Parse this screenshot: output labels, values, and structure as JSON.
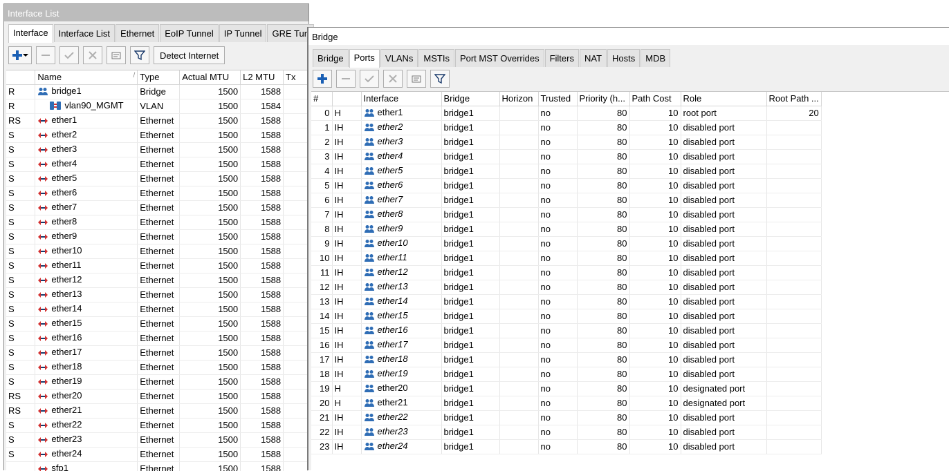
{
  "interface_window": {
    "title": "Interface List",
    "tabs": [
      "Interface",
      "Interface List",
      "Ethernet",
      "EoIP Tunnel",
      "IP Tunnel",
      "GRE Tun"
    ],
    "detect_button": "Detect Internet",
    "columns": [
      "",
      "Name",
      "Type",
      "Actual MTU",
      "L2 MTU",
      "Tx"
    ],
    "rows": [
      {
        "flags": "R",
        "name": "bridge1",
        "type": "Bridge",
        "mtu": "1500",
        "l2mtu": "1588",
        "icon": "bridge-icon"
      },
      {
        "flags": "R",
        "name": "vlan90_MGMT",
        "type": "VLAN",
        "mtu": "1500",
        "l2mtu": "1584",
        "icon": "vlan-icon"
      },
      {
        "flags": "RS",
        "name": "ether1",
        "type": "Ethernet",
        "mtu": "1500",
        "l2mtu": "1588",
        "icon": "ethernet-icon"
      },
      {
        "flags": "S",
        "name": "ether2",
        "type": "Ethernet",
        "mtu": "1500",
        "l2mtu": "1588",
        "icon": "ethernet-icon"
      },
      {
        "flags": "S",
        "name": "ether3",
        "type": "Ethernet",
        "mtu": "1500",
        "l2mtu": "1588",
        "icon": "ethernet-icon"
      },
      {
        "flags": "S",
        "name": "ether4",
        "type": "Ethernet",
        "mtu": "1500",
        "l2mtu": "1588",
        "icon": "ethernet-icon"
      },
      {
        "flags": "S",
        "name": "ether5",
        "type": "Ethernet",
        "mtu": "1500",
        "l2mtu": "1588",
        "icon": "ethernet-icon"
      },
      {
        "flags": "S",
        "name": "ether6",
        "type": "Ethernet",
        "mtu": "1500",
        "l2mtu": "1588",
        "icon": "ethernet-icon"
      },
      {
        "flags": "S",
        "name": "ether7",
        "type": "Ethernet",
        "mtu": "1500",
        "l2mtu": "1588",
        "icon": "ethernet-icon"
      },
      {
        "flags": "S",
        "name": "ether8",
        "type": "Ethernet",
        "mtu": "1500",
        "l2mtu": "1588",
        "icon": "ethernet-icon"
      },
      {
        "flags": "S",
        "name": "ether9",
        "type": "Ethernet",
        "mtu": "1500",
        "l2mtu": "1588",
        "icon": "ethernet-icon"
      },
      {
        "flags": "S",
        "name": "ether10",
        "type": "Ethernet",
        "mtu": "1500",
        "l2mtu": "1588",
        "icon": "ethernet-icon"
      },
      {
        "flags": "S",
        "name": "ether11",
        "type": "Ethernet",
        "mtu": "1500",
        "l2mtu": "1588",
        "icon": "ethernet-icon"
      },
      {
        "flags": "S",
        "name": "ether12",
        "type": "Ethernet",
        "mtu": "1500",
        "l2mtu": "1588",
        "icon": "ethernet-icon"
      },
      {
        "flags": "S",
        "name": "ether13",
        "type": "Ethernet",
        "mtu": "1500",
        "l2mtu": "1588",
        "icon": "ethernet-icon"
      },
      {
        "flags": "S",
        "name": "ether14",
        "type": "Ethernet",
        "mtu": "1500",
        "l2mtu": "1588",
        "icon": "ethernet-icon"
      },
      {
        "flags": "S",
        "name": "ether15",
        "type": "Ethernet",
        "mtu": "1500",
        "l2mtu": "1588",
        "icon": "ethernet-icon"
      },
      {
        "flags": "S",
        "name": "ether16",
        "type": "Ethernet",
        "mtu": "1500",
        "l2mtu": "1588",
        "icon": "ethernet-icon"
      },
      {
        "flags": "S",
        "name": "ether17",
        "type": "Ethernet",
        "mtu": "1500",
        "l2mtu": "1588",
        "icon": "ethernet-icon"
      },
      {
        "flags": "S",
        "name": "ether18",
        "type": "Ethernet",
        "mtu": "1500",
        "l2mtu": "1588",
        "icon": "ethernet-icon"
      },
      {
        "flags": "S",
        "name": "ether19",
        "type": "Ethernet",
        "mtu": "1500",
        "l2mtu": "1588",
        "icon": "ethernet-icon"
      },
      {
        "flags": "RS",
        "name": "ether20",
        "type": "Ethernet",
        "mtu": "1500",
        "l2mtu": "1588",
        "icon": "ethernet-icon"
      },
      {
        "flags": "RS",
        "name": "ether21",
        "type": "Ethernet",
        "mtu": "1500",
        "l2mtu": "1588",
        "icon": "ethernet-icon"
      },
      {
        "flags": "S",
        "name": "ether22",
        "type": "Ethernet",
        "mtu": "1500",
        "l2mtu": "1588",
        "icon": "ethernet-icon"
      },
      {
        "flags": "S",
        "name": "ether23",
        "type": "Ethernet",
        "mtu": "1500",
        "l2mtu": "1588",
        "icon": "ethernet-icon"
      },
      {
        "flags": "S",
        "name": "ether24",
        "type": "Ethernet",
        "mtu": "1500",
        "l2mtu": "1588",
        "icon": "ethernet-icon"
      },
      {
        "flags": "",
        "name": "sfp1",
        "type": "Ethernet",
        "mtu": "1500",
        "l2mtu": "1588",
        "icon": "ethernet-icon"
      }
    ]
  },
  "bridge_window": {
    "title": "Bridge",
    "tabs": [
      "Bridge",
      "Ports",
      "VLANs",
      "MSTIs",
      "Port MST Overrides",
      "Filters",
      "NAT",
      "Hosts",
      "MDB"
    ],
    "active_tab": "Ports",
    "columns": [
      "#",
      "",
      "Interface",
      "Bridge",
      "Horizon",
      "Trusted",
      "Priority (h...",
      "Path Cost",
      "Role",
      "Root Path ..."
    ],
    "rows": [
      {
        "n": "0",
        "flags": "H",
        "iface": "ether1",
        "bridge": "bridge1",
        "horizon": "",
        "trusted": "no",
        "priority": "80",
        "cost": "10",
        "role": "root port",
        "rootpath": "20",
        "disabled": false
      },
      {
        "n": "1",
        "flags": "IH",
        "iface": "ether2",
        "bridge": "bridge1",
        "horizon": "",
        "trusted": "no",
        "priority": "80",
        "cost": "10",
        "role": "disabled port",
        "rootpath": "",
        "disabled": true
      },
      {
        "n": "2",
        "flags": "IH",
        "iface": "ether3",
        "bridge": "bridge1",
        "horizon": "",
        "trusted": "no",
        "priority": "80",
        "cost": "10",
        "role": "disabled port",
        "rootpath": "",
        "disabled": true
      },
      {
        "n": "3",
        "flags": "IH",
        "iface": "ether4",
        "bridge": "bridge1",
        "horizon": "",
        "trusted": "no",
        "priority": "80",
        "cost": "10",
        "role": "disabled port",
        "rootpath": "",
        "disabled": true
      },
      {
        "n": "4",
        "flags": "IH",
        "iface": "ether5",
        "bridge": "bridge1",
        "horizon": "",
        "trusted": "no",
        "priority": "80",
        "cost": "10",
        "role": "disabled port",
        "rootpath": "",
        "disabled": true
      },
      {
        "n": "5",
        "flags": "IH",
        "iface": "ether6",
        "bridge": "bridge1",
        "horizon": "",
        "trusted": "no",
        "priority": "80",
        "cost": "10",
        "role": "disabled port",
        "rootpath": "",
        "disabled": true
      },
      {
        "n": "6",
        "flags": "IH",
        "iface": "ether7",
        "bridge": "bridge1",
        "horizon": "",
        "trusted": "no",
        "priority": "80",
        "cost": "10",
        "role": "disabled port",
        "rootpath": "",
        "disabled": true
      },
      {
        "n": "7",
        "flags": "IH",
        "iface": "ether8",
        "bridge": "bridge1",
        "horizon": "",
        "trusted": "no",
        "priority": "80",
        "cost": "10",
        "role": "disabled port",
        "rootpath": "",
        "disabled": true
      },
      {
        "n": "8",
        "flags": "IH",
        "iface": "ether9",
        "bridge": "bridge1",
        "horizon": "",
        "trusted": "no",
        "priority": "80",
        "cost": "10",
        "role": "disabled port",
        "rootpath": "",
        "disabled": true
      },
      {
        "n": "9",
        "flags": "IH",
        "iface": "ether10",
        "bridge": "bridge1",
        "horizon": "",
        "trusted": "no",
        "priority": "80",
        "cost": "10",
        "role": "disabled port",
        "rootpath": "",
        "disabled": true
      },
      {
        "n": "10",
        "flags": "IH",
        "iface": "ether11",
        "bridge": "bridge1",
        "horizon": "",
        "trusted": "no",
        "priority": "80",
        "cost": "10",
        "role": "disabled port",
        "rootpath": "",
        "disabled": true
      },
      {
        "n": "11",
        "flags": "IH",
        "iface": "ether12",
        "bridge": "bridge1",
        "horizon": "",
        "trusted": "no",
        "priority": "80",
        "cost": "10",
        "role": "disabled port",
        "rootpath": "",
        "disabled": true
      },
      {
        "n": "12",
        "flags": "IH",
        "iface": "ether13",
        "bridge": "bridge1",
        "horizon": "",
        "trusted": "no",
        "priority": "80",
        "cost": "10",
        "role": "disabled port",
        "rootpath": "",
        "disabled": true
      },
      {
        "n": "13",
        "flags": "IH",
        "iface": "ether14",
        "bridge": "bridge1",
        "horizon": "",
        "trusted": "no",
        "priority": "80",
        "cost": "10",
        "role": "disabled port",
        "rootpath": "",
        "disabled": true
      },
      {
        "n": "14",
        "flags": "IH",
        "iface": "ether15",
        "bridge": "bridge1",
        "horizon": "",
        "trusted": "no",
        "priority": "80",
        "cost": "10",
        "role": "disabled port",
        "rootpath": "",
        "disabled": true
      },
      {
        "n": "15",
        "flags": "IH",
        "iface": "ether16",
        "bridge": "bridge1",
        "horizon": "",
        "trusted": "no",
        "priority": "80",
        "cost": "10",
        "role": "disabled port",
        "rootpath": "",
        "disabled": true
      },
      {
        "n": "16",
        "flags": "IH",
        "iface": "ether17",
        "bridge": "bridge1",
        "horizon": "",
        "trusted": "no",
        "priority": "80",
        "cost": "10",
        "role": "disabled port",
        "rootpath": "",
        "disabled": true
      },
      {
        "n": "17",
        "flags": "IH",
        "iface": "ether18",
        "bridge": "bridge1",
        "horizon": "",
        "trusted": "no",
        "priority": "80",
        "cost": "10",
        "role": "disabled port",
        "rootpath": "",
        "disabled": true
      },
      {
        "n": "18",
        "flags": "IH",
        "iface": "ether19",
        "bridge": "bridge1",
        "horizon": "",
        "trusted": "no",
        "priority": "80",
        "cost": "10",
        "role": "disabled port",
        "rootpath": "",
        "disabled": true
      },
      {
        "n": "19",
        "flags": "H",
        "iface": "ether20",
        "bridge": "bridge1",
        "horizon": "",
        "trusted": "no",
        "priority": "80",
        "cost": "10",
        "role": "designated port",
        "rootpath": "",
        "disabled": false
      },
      {
        "n": "20",
        "flags": "H",
        "iface": "ether21",
        "bridge": "bridge1",
        "horizon": "",
        "trusted": "no",
        "priority": "80",
        "cost": "10",
        "role": "designated port",
        "rootpath": "",
        "disabled": false
      },
      {
        "n": "21",
        "flags": "IH",
        "iface": "ether22",
        "bridge": "bridge1",
        "horizon": "",
        "trusted": "no",
        "priority": "80",
        "cost": "10",
        "role": "disabled port",
        "rootpath": "",
        "disabled": true
      },
      {
        "n": "22",
        "flags": "IH",
        "iface": "ether23",
        "bridge": "bridge1",
        "horizon": "",
        "trusted": "no",
        "priority": "80",
        "cost": "10",
        "role": "disabled port",
        "rootpath": "",
        "disabled": true
      },
      {
        "n": "23",
        "flags": "IH",
        "iface": "ether24",
        "bridge": "bridge1",
        "horizon": "",
        "trusted": "no",
        "priority": "80",
        "cost": "10",
        "role": "disabled port",
        "rootpath": "",
        "disabled": true
      }
    ]
  },
  "colors": {
    "accent_blue": "#1a5fb4",
    "eth_red": "#d32f2f",
    "inactive_title": "#bcbcbc"
  }
}
